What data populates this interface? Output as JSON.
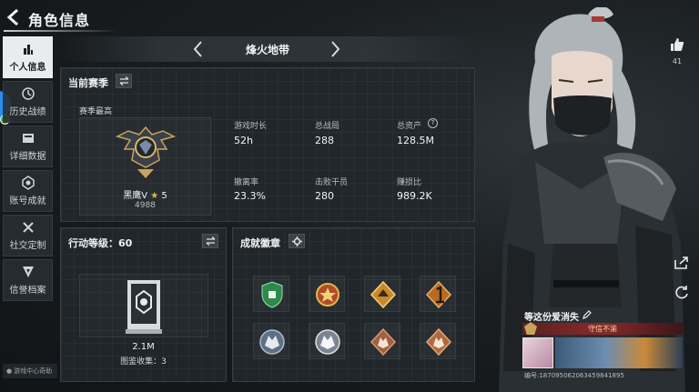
{
  "header": {
    "title": "角色信息"
  },
  "sidebar": {
    "items": [
      {
        "label": "个人信息",
        "icon": "bar-chart-icon",
        "active": true
      },
      {
        "label": "历史战绩",
        "icon": "history-icon",
        "active": false
      },
      {
        "label": "详细数据",
        "icon": "data-card-icon",
        "active": false
      },
      {
        "label": "账号成就",
        "icon": "achievement-icon",
        "active": false
      },
      {
        "label": "社交定制",
        "icon": "tools-icon",
        "active": false
      },
      {
        "label": "信誉档案",
        "icon": "reputation-icon",
        "active": false
      }
    ],
    "support_label": "游戏中心奇助"
  },
  "mode": {
    "name": "烽火地带"
  },
  "season": {
    "title": "当前赛季",
    "best_label": "赛季最高",
    "rank_name": "黑鹰V",
    "rank_stars": "5",
    "rank_score": "4988",
    "stats": [
      {
        "label": "游戏时长",
        "value": "52h"
      },
      {
        "label": "总战局",
        "value": "288"
      },
      {
        "label": "总资产",
        "value": "128.5M"
      },
      {
        "label": "撤离率",
        "value": "23.3%"
      },
      {
        "label": "击败干员",
        "value": "280"
      },
      {
        "label": "赚损比",
        "value": "989.2K"
      }
    ],
    "help_glyph": "?"
  },
  "action_level": {
    "title": "行动等级：60",
    "value": "2.1M",
    "collection_label": "图鉴收集：3"
  },
  "achievements": {
    "title": "成就徽章",
    "badges": [
      {
        "name": "shield-badge",
        "color": "#2f8a4a"
      },
      {
        "name": "star-medal-badge",
        "color": "#b44a2a"
      },
      {
        "name": "gold-emblem-badge",
        "color": "#c98a2a"
      },
      {
        "name": "number-one-badge",
        "color": "#b86a22"
      },
      {
        "name": "wolf-badge-blue",
        "color": "#5e7085"
      },
      {
        "name": "wolf-badge-silver",
        "color": "#7a8590"
      },
      {
        "name": "wolf-badge-bronze",
        "color": "#a06040"
      },
      {
        "name": "wolf-badge-copper",
        "color": "#b06a40"
      }
    ]
  },
  "profile": {
    "likes": "41",
    "player_name": "等这份爱消失",
    "player_title": "守信不渝",
    "player_id": "编号:187095062063459841895"
  },
  "colors": {
    "accent_gold": "#c9a45a",
    "active_tab": "#e9ecee",
    "panel": "#22272b"
  }
}
